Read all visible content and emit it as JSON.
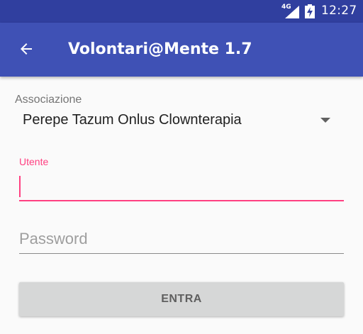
{
  "status_bar": {
    "network_type": "4G",
    "time": "12:27",
    "icons": [
      "signal-icon",
      "battery-charging-icon"
    ]
  },
  "app_bar": {
    "title": "Volontari@Mente 1.7",
    "back_icon": "arrow-back-icon",
    "color": "#3f51b5",
    "status_color": "#303f9f"
  },
  "form": {
    "association": {
      "label": "Associazione",
      "selected": "Perepe Tazum Onlus Clownterapia"
    },
    "user": {
      "label": "Utente",
      "value": "",
      "focused": true
    },
    "password": {
      "placeholder": "Password",
      "value": ""
    },
    "submit_label": "ENTRA"
  },
  "colors": {
    "accent": "#ff4081",
    "primary": "#3f51b5"
  }
}
